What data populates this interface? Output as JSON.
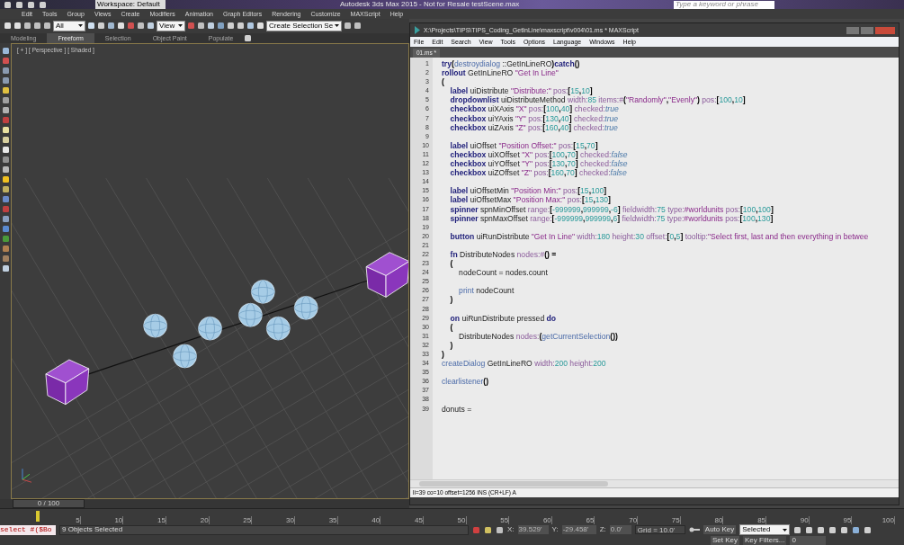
{
  "app": {
    "workspace": "Workspace: Default",
    "title": "Autodesk 3ds Max 2015   -  Not for Resale   testScene.max",
    "search_placeholder": "Type a keyword or phrase"
  },
  "menu": [
    "Edit",
    "Tools",
    "Group",
    "Views",
    "Create",
    "Modifiers",
    "Animation",
    "Graph Editors",
    "Rendering",
    "Customize",
    "MAXScript",
    "Help"
  ],
  "toolbar": {
    "selection_filter": "All",
    "reference_coord": "View",
    "named_selection": "Create Selection Se"
  },
  "ribbon_tabs": [
    {
      "label": "Modeling",
      "selected": false
    },
    {
      "label": "Freeform",
      "selected": true
    },
    {
      "label": "Selection",
      "selected": false
    },
    {
      "label": "Object Paint",
      "selected": false
    },
    {
      "label": "Populate",
      "selected": false
    }
  ],
  "viewport": {
    "labels": [
      "[ + ]",
      "[ Perspective ]",
      "[ Shaded ]"
    ]
  },
  "time_slider": {
    "label": "0 / 100"
  },
  "timeline_ticks": [
    "5",
    "10",
    "15",
    "20",
    "25",
    "30",
    "35",
    "40",
    "45",
    "50",
    "55",
    "60",
    "65",
    "70",
    "75",
    "80",
    "85",
    "90",
    "95",
    "100"
  ],
  "status": {
    "listener": "select #($Bo",
    "selection": "9 Objects Selected",
    "x_label": "X:",
    "x": "39.529'",
    "y_label": "Y:",
    "y": "-29.458'",
    "z_label": "Z:",
    "z": "0.0'",
    "grid": "Grid = 10.0'",
    "auto_key": "Auto Key",
    "key_mode": "Selected",
    "set_key": "Set Key",
    "key_filters": "Key Filters...",
    "frame": "0"
  },
  "editor": {
    "title": "X:\\Projects\\TIPS\\TIPS_Coding_GetInLine\\maxscript\\v004\\01.ms * MAXScript",
    "menu": [
      "File",
      "Edit",
      "Search",
      "View",
      "Tools",
      "Options",
      "Language",
      "Windows",
      "Help"
    ],
    "tabs": [
      {
        "label": "01.ms *",
        "selected": true
      }
    ],
    "lines": [
      {
        "number": "1",
        "tokens": [
          {
            "kind": "keyword",
            "text": "try"
          },
          {
            "kind": "punctuation",
            "text": "("
          },
          {
            "kind": "function",
            "text": "destroydialog"
          },
          {
            "kind": "identifier",
            "text": " ::GetInLineRO"
          },
          {
            "kind": "punctuation",
            "text": ")"
          },
          {
            "kind": "keyword",
            "text": "catch"
          },
          {
            "kind": "punctuation",
            "text": "()"
          }
        ]
      },
      {
        "number": "2",
        "tokens": [
          {
            "kind": "keyword",
            "text": "rollout"
          },
          {
            "kind": "identifier",
            "text": " GetInLineRO "
          },
          {
            "kind": "string",
            "text": "\"Get In Line\""
          }
        ]
      },
      {
        "number": "3",
        "tokens": [
          {
            "kind": "punctuation",
            "text": "("
          }
        ]
      },
      {
        "number": "4",
        "tokens": [
          {
            "kind": "keyword",
            "text": "    label"
          },
          {
            "kind": "identifier",
            "text": " uiDistribute "
          },
          {
            "kind": "string",
            "text": "\"Distribute:\""
          },
          {
            "kind": "property",
            "text": " pos:"
          },
          {
            "kind": "punctuation",
            "text": "["
          },
          {
            "kind": "number",
            "text": "15"
          },
          {
            "kind": "punctuation",
            "text": ","
          },
          {
            "kind": "number",
            "text": "10"
          },
          {
            "kind": "punctuation",
            "text": "]"
          }
        ]
      },
      {
        "number": "5",
        "tokens": [
          {
            "kind": "keyword",
            "text": "    dropdownlist"
          },
          {
            "kind": "identifier",
            "text": " uiDistributeMethod "
          },
          {
            "kind": "property",
            "text": "width:"
          },
          {
            "kind": "number",
            "text": "85"
          },
          {
            "kind": "property",
            "text": " items:#"
          },
          {
            "kind": "punctuation",
            "text": "("
          },
          {
            "kind": "string",
            "text": "\"Randomly\""
          },
          {
            "kind": "punctuation",
            "text": ","
          },
          {
            "kind": "string",
            "text": "\"Evenly\""
          },
          {
            "kind": "punctuation",
            "text": ")"
          },
          {
            "kind": "property",
            "text": " pos:"
          },
          {
            "kind": "punctuation",
            "text": "["
          },
          {
            "kind": "number",
            "text": "100"
          },
          {
            "kind": "punctuation",
            "text": ","
          },
          {
            "kind": "number",
            "text": "10"
          },
          {
            "kind": "punctuation",
            "text": "]"
          }
        ]
      },
      {
        "number": "6",
        "tokens": [
          {
            "kind": "keyword",
            "text": "    checkbox"
          },
          {
            "kind": "identifier",
            "text": " uiXAxis "
          },
          {
            "kind": "string",
            "text": "\"X\""
          },
          {
            "kind": "property",
            "text": " pos:"
          },
          {
            "kind": "punctuation",
            "text": "["
          },
          {
            "kind": "number",
            "text": "100"
          },
          {
            "kind": "punctuation",
            "text": ","
          },
          {
            "kind": "number",
            "text": "40"
          },
          {
            "kind": "punctuation",
            "text": "]"
          },
          {
            "kind": "property",
            "text": " checked:"
          },
          {
            "kind": "boolean",
            "text": "true"
          }
        ]
      },
      {
        "number": "7",
        "tokens": [
          {
            "kind": "keyword",
            "text": "    checkbox"
          },
          {
            "kind": "identifier",
            "text": " uiYAxis "
          },
          {
            "kind": "string",
            "text": "\"Y\""
          },
          {
            "kind": "property",
            "text": " pos:"
          },
          {
            "kind": "punctuation",
            "text": "["
          },
          {
            "kind": "number",
            "text": "130"
          },
          {
            "kind": "punctuation",
            "text": ","
          },
          {
            "kind": "number",
            "text": "40"
          },
          {
            "kind": "punctuation",
            "text": "]"
          },
          {
            "kind": "property",
            "text": " checked:"
          },
          {
            "kind": "boolean",
            "text": "true"
          }
        ]
      },
      {
        "number": "8",
        "tokens": [
          {
            "kind": "keyword",
            "text": "    checkbox"
          },
          {
            "kind": "identifier",
            "text": " uiZAxis "
          },
          {
            "kind": "string",
            "text": "\"Z\""
          },
          {
            "kind": "property",
            "text": " pos:"
          },
          {
            "kind": "punctuation",
            "text": "["
          },
          {
            "kind": "number",
            "text": "160"
          },
          {
            "kind": "punctuation",
            "text": ","
          },
          {
            "kind": "number",
            "text": "40"
          },
          {
            "kind": "punctuation",
            "text": "]"
          },
          {
            "kind": "property",
            "text": " checked:"
          },
          {
            "kind": "boolean",
            "text": "true"
          }
        ]
      },
      {
        "number": "9"
      },
      {
        "number": "10",
        "tokens": [
          {
            "kind": "keyword",
            "text": "    label"
          },
          {
            "kind": "identifier",
            "text": " uiOffset "
          },
          {
            "kind": "string",
            "text": "\"Position Offset:\""
          },
          {
            "kind": "property",
            "text": " pos:"
          },
          {
            "kind": "punctuation",
            "text": "["
          },
          {
            "kind": "number",
            "text": "15"
          },
          {
            "kind": "punctuation",
            "text": ","
          },
          {
            "kind": "number",
            "text": "70"
          },
          {
            "kind": "punctuation",
            "text": "]"
          }
        ]
      },
      {
        "number": "11",
        "tokens": [
          {
            "kind": "keyword",
            "text": "    checkbox"
          },
          {
            "kind": "identifier",
            "text": " uiXOffset "
          },
          {
            "kind": "string",
            "text": "\"X\""
          },
          {
            "kind": "property",
            "text": " pos:"
          },
          {
            "kind": "punctuation",
            "text": "["
          },
          {
            "kind": "number",
            "text": "100"
          },
          {
            "kind": "punctuation",
            "text": ","
          },
          {
            "kind": "number",
            "text": "70"
          },
          {
            "kind": "punctuation",
            "text": "]"
          },
          {
            "kind": "property",
            "text": " checked:"
          },
          {
            "kind": "boolean",
            "text": "false"
          }
        ]
      },
      {
        "number": "12",
        "tokens": [
          {
            "kind": "keyword",
            "text": "    checkbox"
          },
          {
            "kind": "identifier",
            "text": " uiYOffset "
          },
          {
            "kind": "string",
            "text": "\"Y\""
          },
          {
            "kind": "property",
            "text": " pos:"
          },
          {
            "kind": "punctuation",
            "text": "["
          },
          {
            "kind": "number",
            "text": "130"
          },
          {
            "kind": "punctuation",
            "text": ","
          },
          {
            "kind": "number",
            "text": "70"
          },
          {
            "kind": "punctuation",
            "text": "]"
          },
          {
            "kind": "property",
            "text": " checked:"
          },
          {
            "kind": "boolean",
            "text": "false"
          }
        ]
      },
      {
        "number": "13",
        "tokens": [
          {
            "kind": "keyword",
            "text": "    checkbox"
          },
          {
            "kind": "identifier",
            "text": " uiZOffset "
          },
          {
            "kind": "string",
            "text": "\"Z\""
          },
          {
            "kind": "property",
            "text": " pos:"
          },
          {
            "kind": "punctuation",
            "text": "["
          },
          {
            "kind": "number",
            "text": "160"
          },
          {
            "kind": "punctuation",
            "text": ","
          },
          {
            "kind": "number",
            "text": "70"
          },
          {
            "kind": "punctuation",
            "text": "]"
          },
          {
            "kind": "property",
            "text": " checked:"
          },
          {
            "kind": "boolean",
            "text": "false"
          }
        ]
      },
      {
        "number": "14"
      },
      {
        "number": "15",
        "tokens": [
          {
            "kind": "keyword",
            "text": "    label"
          },
          {
            "kind": "identifier",
            "text": " uiOffsetMin "
          },
          {
            "kind": "string",
            "text": "\"Position Min:\""
          },
          {
            "kind": "property",
            "text": " pos:"
          },
          {
            "kind": "punctuation",
            "text": "["
          },
          {
            "kind": "number",
            "text": "15"
          },
          {
            "kind": "punctuation",
            "text": ","
          },
          {
            "kind": "number",
            "text": "100"
          },
          {
            "kind": "punctuation",
            "text": "]"
          }
        ]
      },
      {
        "number": "16",
        "tokens": [
          {
            "kind": "keyword",
            "text": "    label"
          },
          {
            "kind": "identifier",
            "text": " uiOffsetMax "
          },
          {
            "kind": "string",
            "text": "\"Position Max:\""
          },
          {
            "kind": "property",
            "text": " pos:"
          },
          {
            "kind": "punctuation",
            "text": "["
          },
          {
            "kind": "number",
            "text": "15"
          },
          {
            "kind": "punctuation",
            "text": ","
          },
          {
            "kind": "number",
            "text": "130"
          },
          {
            "kind": "punctuation",
            "text": "]"
          }
        ]
      },
      {
        "number": "17",
        "tokens": [
          {
            "kind": "keyword",
            "text": "    spinner"
          },
          {
            "kind": "identifier",
            "text": " spnMinOffset "
          },
          {
            "kind": "property",
            "text": "range:"
          },
          {
            "kind": "punctuation",
            "text": "["
          },
          {
            "kind": "number",
            "text": "-999999"
          },
          {
            "kind": "punctuation",
            "text": ","
          },
          {
            "kind": "number",
            "text": "999999"
          },
          {
            "kind": "punctuation",
            "text": ","
          },
          {
            "kind": "number",
            "text": "-6"
          },
          {
            "kind": "punctuation",
            "text": "]"
          },
          {
            "kind": "property",
            "text": " fieldwidth:"
          },
          {
            "kind": "number",
            "text": "75"
          },
          {
            "kind": "property",
            "text": " type:"
          },
          {
            "kind": "string",
            "text": "#worldunits"
          },
          {
            "kind": "property",
            "text": " pos:"
          },
          {
            "kind": "punctuation",
            "text": "["
          },
          {
            "kind": "number",
            "text": "100"
          },
          {
            "kind": "punctuation",
            "text": ","
          },
          {
            "kind": "number",
            "text": "100"
          },
          {
            "kind": "punctuation",
            "text": "]"
          }
        ]
      },
      {
        "number": "18",
        "tokens": [
          {
            "kind": "keyword",
            "text": "    spinner"
          },
          {
            "kind": "identifier",
            "text": " spnMaxOffset "
          },
          {
            "kind": "property",
            "text": "range:"
          },
          {
            "kind": "punctuation",
            "text": "["
          },
          {
            "kind": "number",
            "text": "-999999"
          },
          {
            "kind": "punctuation",
            "text": ","
          },
          {
            "kind": "number",
            "text": "999999"
          },
          {
            "kind": "punctuation",
            "text": ","
          },
          {
            "kind": "number",
            "text": "6"
          },
          {
            "kind": "punctuation",
            "text": "]"
          },
          {
            "kind": "property",
            "text": " fieldwidth:"
          },
          {
            "kind": "number",
            "text": "75"
          },
          {
            "kind": "property",
            "text": " type:"
          },
          {
            "kind": "string",
            "text": "#worldunits"
          },
          {
            "kind": "property",
            "text": " pos:"
          },
          {
            "kind": "punctuation",
            "text": "["
          },
          {
            "kind": "number",
            "text": "100"
          },
          {
            "kind": "punctuation",
            "text": ","
          },
          {
            "kind": "number",
            "text": "130"
          },
          {
            "kind": "punctuation",
            "text": "]"
          }
        ]
      },
      {
        "number": "19"
      },
      {
        "number": "20",
        "tokens": [
          {
            "kind": "keyword",
            "text": "    button"
          },
          {
            "kind": "identifier",
            "text": " uiRunDistribute "
          },
          {
            "kind": "string",
            "text": "\"Get In Line\""
          },
          {
            "kind": "property",
            "text": " width:"
          },
          {
            "kind": "number",
            "text": "180"
          },
          {
            "kind": "property",
            "text": " height:"
          },
          {
            "kind": "number",
            "text": "30"
          },
          {
            "kind": "property",
            "text": " offset:"
          },
          {
            "kind": "punctuation",
            "text": "["
          },
          {
            "kind": "number",
            "text": "0"
          },
          {
            "kind": "punctuation",
            "text": ","
          },
          {
            "kind": "number",
            "text": "5"
          },
          {
            "kind": "punctuation",
            "text": "]"
          },
          {
            "kind": "property",
            "text": " tooltip:"
          },
          {
            "kind": "string",
            "text": "\"Select first, last and then everything in betwee"
          }
        ]
      },
      {
        "number": "21"
      },
      {
        "number": "22",
        "tokens": [
          {
            "kind": "keyword",
            "text": "    fn"
          },
          {
            "kind": "identifier",
            "text": " DistributeNodes "
          },
          {
            "kind": "property",
            "text": "nodes:#"
          },
          {
            "kind": "punctuation",
            "text": "() ="
          }
        ]
      },
      {
        "number": "23",
        "tokens": [
          {
            "kind": "punctuation",
            "text": "    ("
          }
        ]
      },
      {
        "number": "24",
        "tokens": [
          {
            "kind": "identifier",
            "text": "        nodeCount = nodes.count"
          }
        ]
      },
      {
        "number": "25"
      },
      {
        "number": "26",
        "tokens": [
          {
            "kind": "function",
            "text": "        print"
          },
          {
            "kind": "identifier",
            "text": " nodeCount"
          }
        ]
      },
      {
        "number": "27",
        "tokens": [
          {
            "kind": "punctuation",
            "text": "    )"
          }
        ]
      },
      {
        "number": "28"
      },
      {
        "number": "29",
        "tokens": [
          {
            "kind": "keyword",
            "text": "    on"
          },
          {
            "kind": "identifier",
            "text": " uiRunDistribute pressed "
          },
          {
            "kind": "keyword",
            "text": "do"
          }
        ]
      },
      {
        "number": "30",
        "tokens": [
          {
            "kind": "punctuation",
            "text": "    ("
          }
        ]
      },
      {
        "number": "31",
        "tokens": [
          {
            "kind": "identifier",
            "text": "        DistributeNodes "
          },
          {
            "kind": "property",
            "text": "nodes:"
          },
          {
            "kind": "punctuation",
            "text": "("
          },
          {
            "kind": "function",
            "text": "getCurrentSelection"
          },
          {
            "kind": "punctuation",
            "text": "())"
          }
        ]
      },
      {
        "number": "32",
        "tokens": [
          {
            "kind": "punctuation",
            "text": "    )"
          }
        ]
      },
      {
        "number": "33",
        "tokens": [
          {
            "kind": "punctuation",
            "text": ")"
          }
        ]
      },
      {
        "number": "34",
        "tokens": [
          {
            "kind": "function",
            "text": "createDialog"
          },
          {
            "kind": "identifier",
            "text": " GetInLineRO "
          },
          {
            "kind": "property",
            "text": "width:"
          },
          {
            "kind": "number",
            "text": "200"
          },
          {
            "kind": "property",
            "text": " height:"
          },
          {
            "kind": "number",
            "text": "200"
          }
        ]
      },
      {
        "number": "35"
      },
      {
        "number": "36",
        "tokens": [
          {
            "kind": "function",
            "text": "clearlistener"
          },
          {
            "kind": "punctuation",
            "text": "()"
          }
        ]
      },
      {
        "number": "37"
      },
      {
        "number": "38"
      },
      {
        "number": "39",
        "tokens": [
          {
            "kind": "identifier",
            "text": "donuts ="
          }
        ]
      }
    ],
    "status": "li=39 co=10 offset=1256 INS (CR+LF) A"
  }
}
